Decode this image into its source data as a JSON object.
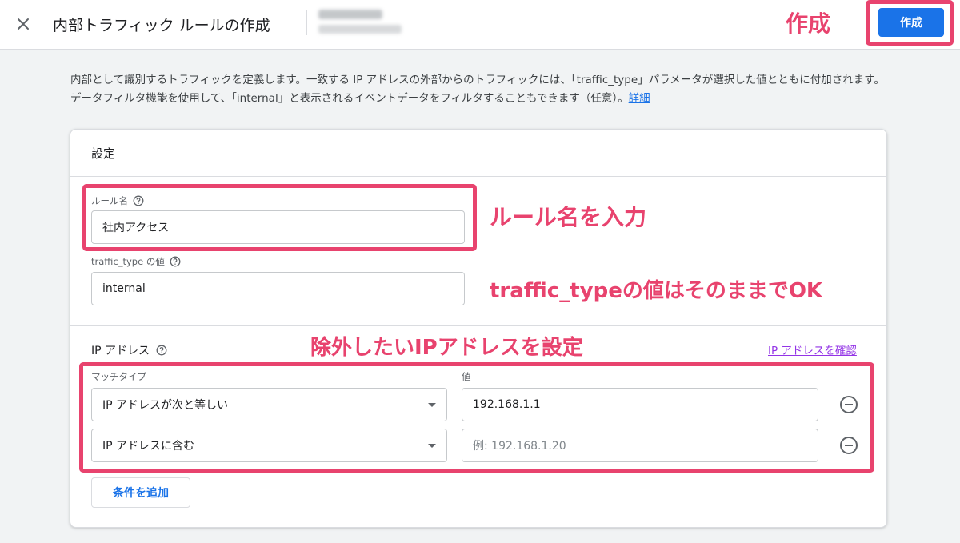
{
  "header": {
    "title": "内部トラフィック ルールの作成",
    "create_label": "作成"
  },
  "description": {
    "text": "内部として識別するトラフィックを定義します。一致する IP アドレスの外部からのトラフィックには、「traffic_type」パラメータが選択した値とともに付加されます。データフィルタ機能を使用して、「internal」と表示されるイベントデータをフィルタすることもできます（任意）。",
    "link": "詳細"
  },
  "card": {
    "title": "設定",
    "rule_name": {
      "label": "ルール名",
      "value": "社内アクセス"
    },
    "traffic_type": {
      "label": "traffic_type の値",
      "value": "internal"
    },
    "ip_section": {
      "title": "IP アドレス",
      "verify_link": "IP アドレスを確認",
      "match_type_header": "マッチタイプ",
      "value_header": "値",
      "conditions": [
        {
          "match_type": "IP アドレスが次と等しい",
          "value": "192.168.1.1",
          "placeholder": ""
        },
        {
          "match_type": "IP アドレスに含む",
          "value": "",
          "placeholder": "例: 192.168.1.20"
        }
      ],
      "add_condition": "条件を追加"
    }
  },
  "annotations": {
    "create": "作成",
    "rule_name": "ルール名を入力",
    "traffic_type": "traffic_typeの値はそのままでOK",
    "ip": "除外したいIPアドレスを設定"
  },
  "colors": {
    "accent": "#1a73e8",
    "annotation": "#e8436e",
    "link_visited": "#9334e6"
  }
}
